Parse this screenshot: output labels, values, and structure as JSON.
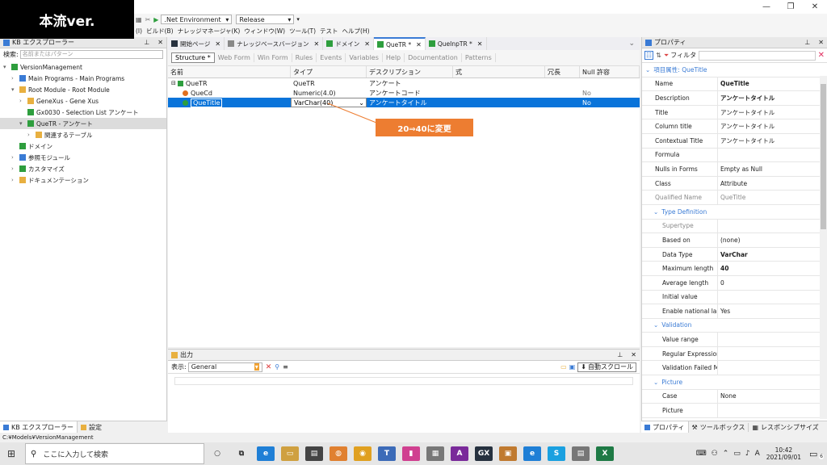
{
  "overlay_label": "本流ver.",
  "toolbar": {
    "env_combo": ".Net Environment",
    "config_combo": "Release"
  },
  "menu": [
    "(I)",
    "ビルド(B)",
    "ナレッジマネージャ(K)",
    "ウィンドウ(W)",
    "ツール(T)",
    "テスト",
    "ヘルプ(H)"
  ],
  "left_panel": {
    "title": "KB エクスプローラー",
    "filter_label": "検索:",
    "filter_placeholder": "名前またはパターン",
    "tree": [
      {
        "label": "VersionManagement",
        "level": 0,
        "expander": "▾"
      },
      {
        "label": "Main Programs - Main Programs",
        "level": 1,
        "expander": "›"
      },
      {
        "label": "Root Module - Root Module",
        "level": 1,
        "expander": "▾"
      },
      {
        "label": "GeneXus - Gene Xus",
        "level": 2,
        "expander": "›"
      },
      {
        "label": "Gx0030 - Selection List アンケート",
        "level": 2,
        "expander": ""
      },
      {
        "label": "QueTR - アンケート",
        "level": 2,
        "expander": "▾"
      },
      {
        "label": "関連するテーブル",
        "level": 3,
        "expander": "›"
      },
      {
        "label": "ドメイン",
        "level": 1,
        "expander": ""
      },
      {
        "label": "参照モジュール",
        "level": 1,
        "expander": "›"
      },
      {
        "label": "カスタマイズ",
        "level": 1,
        "expander": "›"
      },
      {
        "label": "ドキュメンテーション",
        "level": 1,
        "expander": "›"
      }
    ],
    "bottom_tabs": [
      "KB エクスプローラー",
      "設定"
    ]
  },
  "doc_tabs": [
    {
      "label": "開始ページ"
    },
    {
      "label": "ナレッジベースバージョン"
    },
    {
      "label": "ドメイン"
    },
    {
      "label": "QueTR *",
      "active": true
    },
    {
      "label": "QueInpTR *"
    }
  ],
  "sub_tabs": [
    "Structure *",
    "Web Form",
    "Win Form",
    "Rules",
    "Events",
    "Variables",
    "Help",
    "Documentation",
    "Patterns"
  ],
  "grid": {
    "headers": [
      "名前",
      "タイプ",
      "デスクリプション",
      "式",
      "冗長",
      "Null 許容"
    ],
    "rows": [
      {
        "name": "QueTR",
        "type": "QueTR",
        "desc": "アンケート",
        "null": "",
        "level": 0
      },
      {
        "name": "QueCd",
        "type": "Numeric(4.0)",
        "desc": "アンケートコード",
        "null": "No",
        "level": 1
      },
      {
        "name": "QueTitle",
        "type": "VarChar(40)",
        "desc": "アンケートタイトル",
        "null": "No",
        "level": 1,
        "selected": true
      }
    ]
  },
  "callout": "20⇒40に変更",
  "output": {
    "title": "出力",
    "show_label": "表示:",
    "show_value": "General",
    "autoscroll": "自動スクロール"
  },
  "properties": {
    "title": "プロパティ",
    "filter_label": "フィルタ",
    "section": "項目属性: QueTitle",
    "rows": [
      {
        "name": "Name",
        "value": "QueTitle",
        "bold": true
      },
      {
        "name": "Description",
        "value": "アンケートタイトル",
        "bold": true
      },
      {
        "name": "Title",
        "value": "アンケートタイトル"
      },
      {
        "name": "Column title",
        "value": "アンケートタイトル"
      },
      {
        "name": "Contextual Title",
        "value": "アンケートタイトル"
      },
      {
        "name": "Formula",
        "value": ""
      },
      {
        "name": "Nulls in Forms",
        "value": "Empty as Null"
      },
      {
        "name": "Class",
        "value": "Attribute"
      },
      {
        "name": "Qualified Name",
        "value": "QueTitle",
        "gray": true
      },
      {
        "category": "Type Definition"
      },
      {
        "name": "Supertype",
        "value": "",
        "indent": true,
        "gray": true
      },
      {
        "name": "Based on",
        "value": "(none)",
        "indent": true
      },
      {
        "name": "Data Type",
        "value": "VarChar",
        "indent": true,
        "bold": true
      },
      {
        "name": "Maximum length",
        "value": "40",
        "indent": true,
        "bold": true
      },
      {
        "name": "Average length",
        "value": "0",
        "indent": true
      },
      {
        "name": "Initial value",
        "value": "",
        "indent": true
      },
      {
        "name": "Enable national lang",
        "value": "Yes",
        "indent": true
      },
      {
        "category": "Validation"
      },
      {
        "name": "Value range",
        "value": "",
        "indent": true
      },
      {
        "name": "Regular Expression",
        "value": "",
        "indent": true
      },
      {
        "name": "Validation Failed Me",
        "value": "",
        "indent": true
      },
      {
        "category": "Picture"
      },
      {
        "name": "Case",
        "value": "None",
        "indent": true
      },
      {
        "name": "Picture",
        "value": "",
        "indent": true
      }
    ],
    "bottom_tabs": [
      "プロパティ",
      "ツールボックス",
      "レスポンシブサイズ"
    ]
  },
  "status_path": "C:¥Models¥VersionManagement",
  "taskbar": {
    "search_placeholder": "ここに入力して検索",
    "time": "10:42",
    "date": "2021/09/01",
    "notification_count": "6",
    "ime_label": "A"
  },
  "colors": {
    "accent": "#0a74da",
    "callout": "#ed7d31"
  }
}
